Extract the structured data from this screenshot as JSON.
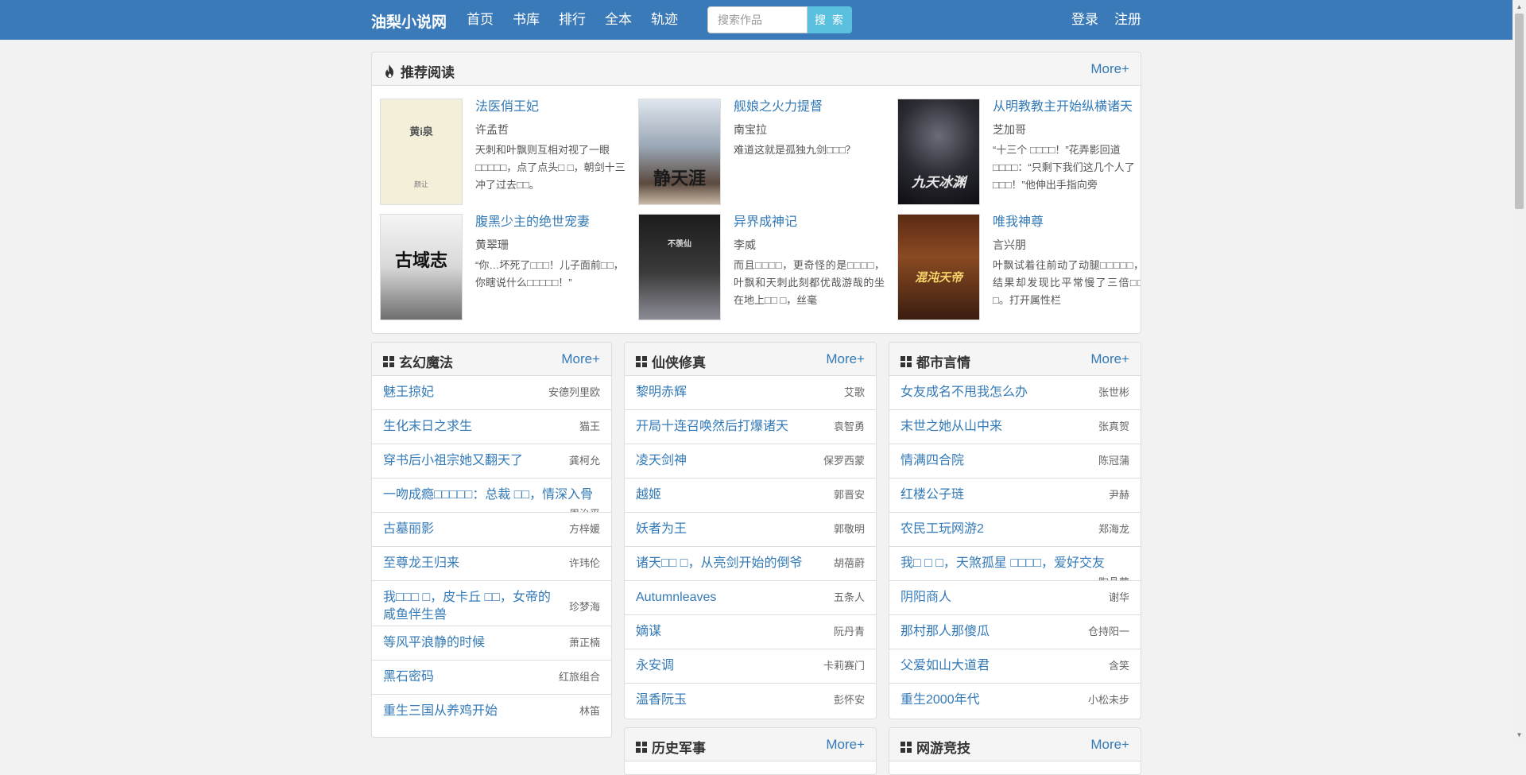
{
  "navbar": {
    "brand": "油梨小说网",
    "links": [
      "首页",
      "书库",
      "排行",
      "全本",
      "轨迹"
    ],
    "search_placeholder": "搜索作品",
    "search_button": "搜 索",
    "login": "登录",
    "register": "注册"
  },
  "recommend": {
    "title": "推荐阅读",
    "more": "More+",
    "books": [
      {
        "title": "法医俏王妃",
        "author": "许孟哲",
        "desc": "天刺和叶飘则互相对视了一眼□□□□□，点了点头□ □，朝剑十三冲了过去□□。",
        "cover_text": "黄i泉",
        "cover_sub": "颜让"
      },
      {
        "title": "舰娘之火力提督",
        "author": "南宝拉",
        "desc": "难道这就是孤独九剑□□□？",
        "cover_text": "静天涯",
        "cover_sub": ""
      },
      {
        "title": "从明教教主开始纵横诸天",
        "author": "芝加哥",
        "desc": "“十三个 □□□□！”花弄影回道□□□□：“只剩下我们这几个人了 □□□！”他伸出手指向旁",
        "cover_text": "九天冰渊",
        "cover_sub": ""
      },
      {
        "title": "腹黑少主的绝世宠妻",
        "author": "黄翠珊",
        "desc": "“你…坏死了□□□！儿子面前□□，你瞎说什么□□□□□！”",
        "cover_text": "古域志",
        "cover_sub": ""
      },
      {
        "title": "异界成神记",
        "author": "李威",
        "desc": "而且□□□□，更奇怪的是□□□□，叶飘和天刺此刻都优哉游哉的坐在地上□□ □，丝毫",
        "cover_text": "不羡仙",
        "cover_sub": ""
      },
      {
        "title": "唯我神尊",
        "author": "言兴朋",
        "desc": "叶飘试着往前动了动腿□□□□□，结果却发现比平常慢了三倍□□ □。打开属性栏",
        "cover_text": "混沌天帝",
        "cover_sub": ""
      }
    ]
  },
  "columns": [
    {
      "title": "玄幻魔法",
      "more": "More+",
      "items": [
        {
          "title": "魅王掠妃",
          "author": "安德列里欧"
        },
        {
          "title": "生化末日之求生",
          "author": "猫王"
        },
        {
          "title": "穿书后小祖宗她又翻天了",
          "author": "龚柯允"
        },
        {
          "title": "一吻成瘾□□□□□：总裁 □□，情深入骨",
          "author": "周治平"
        },
        {
          "title": "古墓丽影",
          "author": "方梓媛"
        },
        {
          "title": "至尊龙王归来",
          "author": "许玮伦"
        },
        {
          "title": "我□□□ □，皮卡丘 □□，女帝的咸鱼伴生兽",
          "author": "珍梦海"
        },
        {
          "title": "等风平浪静的时候",
          "author": "萧正楠"
        },
        {
          "title": "黑石密码",
          "author": "红旅组合"
        },
        {
          "title": "重生三国从养鸡开始",
          "author": "林笛"
        }
      ]
    },
    {
      "title": "仙侠修真",
      "more": "More+",
      "items": [
        {
          "title": "黎明赤辉",
          "author": "艾歌"
        },
        {
          "title": "开局十连召唤然后打爆诸天",
          "author": "袁智勇"
        },
        {
          "title": "凌天剑神",
          "author": "保罗西蒙"
        },
        {
          "title": "越姬",
          "author": "郭晋安"
        },
        {
          "title": "妖者为王",
          "author": "郭敬明"
        },
        {
          "title": "诸天□□ □，从亮剑开始的倒爷",
          "author": "胡蓓蔚"
        },
        {
          "title": "Autumnleaves",
          "author": "五条人"
        },
        {
          "title": "嫡谋",
          "author": "阮丹青"
        },
        {
          "title": "永安调",
          "author": "卡莉赛门"
        },
        {
          "title": "温香阮玉",
          "author": "彭怀安"
        }
      ]
    },
    {
      "title": "都市言情",
      "more": "More+",
      "items": [
        {
          "title": "女友成名不甩我怎么办",
          "author": "张世彬"
        },
        {
          "title": "末世之她从山中来",
          "author": "张真贺"
        },
        {
          "title": "情满四合院",
          "author": "陈冠蒲"
        },
        {
          "title": "红楼公子琏",
          "author": "尹赫"
        },
        {
          "title": "农民工玩网游2",
          "author": "郑海龙"
        },
        {
          "title": "我□ □ □，天煞孤星 □□□□，爱好交友",
          "author": "陶晶莹"
        },
        {
          "title": "阴阳商人",
          "author": "谢华"
        },
        {
          "title": "那村那人那傻瓜",
          "author": "仓持阳一"
        },
        {
          "title": "父爱如山大道君",
          "author": "含笑"
        },
        {
          "title": "重生2000年代",
          "author": "小松未步"
        }
      ]
    }
  ],
  "bottom_panels": [
    {
      "title": "历史军事",
      "more": "More+"
    },
    {
      "title": "网游竞技",
      "more": "More+"
    }
  ],
  "colors": {
    "navbar": "#3b7ab9",
    "link": "#337ab7",
    "search_button": "#5bc0de"
  }
}
